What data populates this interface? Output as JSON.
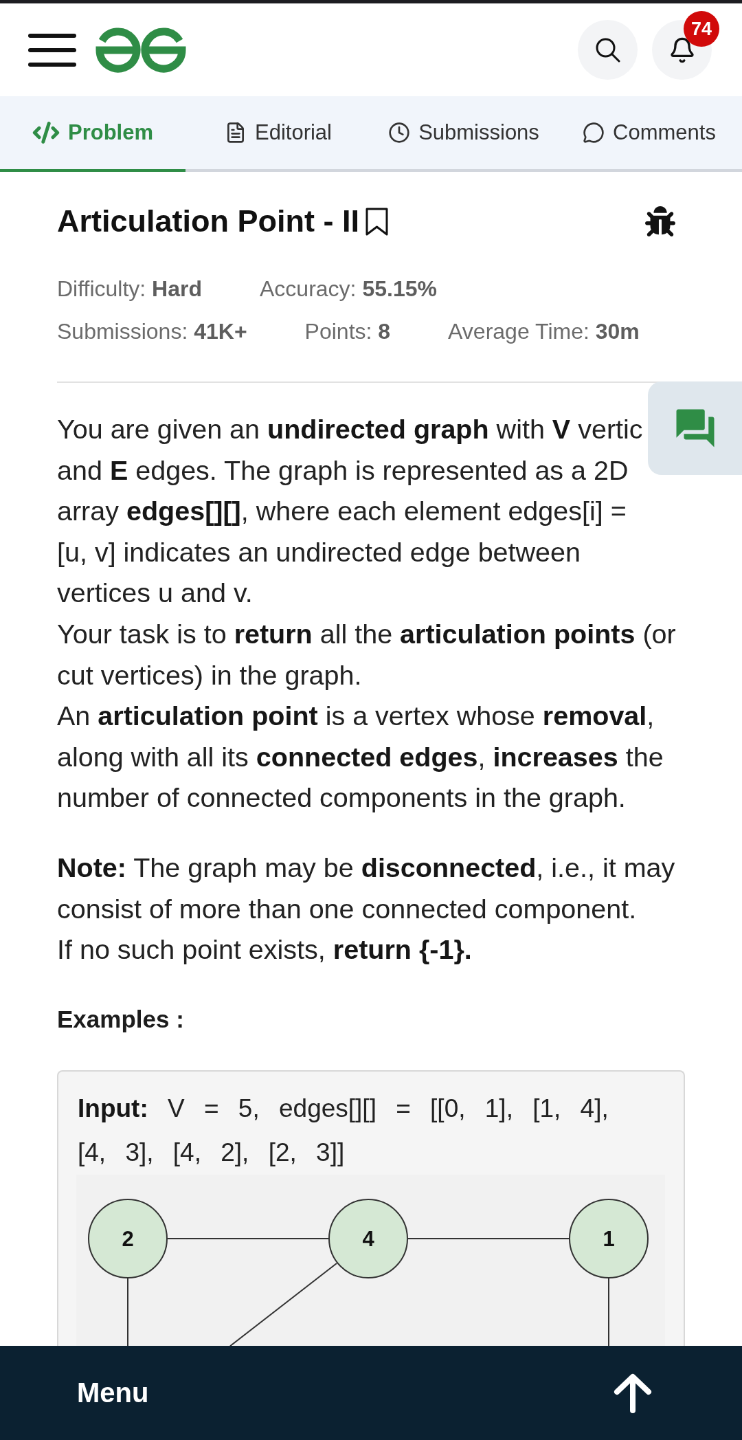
{
  "header": {
    "notification_count": "74"
  },
  "tabs": [
    {
      "label": "Problem",
      "selected": true
    },
    {
      "label": "Editorial",
      "selected": false
    },
    {
      "label": "Submissions",
      "selected": false
    },
    {
      "label": "Comments",
      "selected": false
    }
  ],
  "problem": {
    "title": "Articulation Point - II",
    "stat_rows": [
      {
        "items": [
          "Difficulty: **Hard**",
          "Accuracy: **55.15%**"
        ]
      },
      {
        "items": [
          "Submissions: **41K+**",
          "Points: **8**",
          "Average Time: **30m**"
        ]
      }
    ]
  },
  "description": [
    {
      "lines": [
        "You are given an **undirected graph** with **V** vertic",
        "and **E** edges. The graph is represented as a 2D",
        "array **edges[][]**, where each element edges[i] =",
        "[u, v] indicates an undirected edge between",
        "vertices u and v."
      ]
    },
    {
      "lines": [
        "Your task is to **return** all the **articulation points** (or",
        "cut vertices) in the graph."
      ]
    },
    {
      "lines": [
        "An **articulation point** is a vertex whose **removal**,",
        "along with all its **connected edges**, **increases** the",
        "number of connected components in the graph."
      ]
    }
  ],
  "note": {
    "lines": [
      "**Note:** The graph may be **disconnected**, i.e., it may",
      "consist of more than one connected component.",
      "If no such point exists, **return {-1}.**"
    ]
  },
  "examples": {
    "heading": "Examples :",
    "input_lines": [
      "**Input:** V = 5, edges[][] = [[0, 1], [1, 4],",
      "[4, 3], [4, 2], [2, 3]]"
    ],
    "graph": {
      "nodes": [
        {
          "label": "2"
        },
        {
          "label": "4"
        },
        {
          "label": "1"
        }
      ]
    }
  },
  "bottom_bar": {
    "menu_label": "Menu"
  }
}
